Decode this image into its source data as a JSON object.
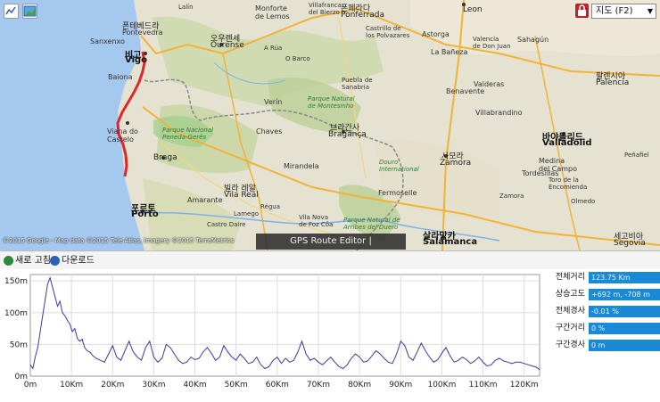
{
  "map": {
    "toolbar": {
      "measure_icon": "route-chart-icon",
      "image_icon": "landscape-image-icon"
    },
    "lock_icon": "padlock-icon",
    "map_type_select": "지도 (F2)",
    "copyright": "©2015 Google - Map data ©2015 Tele Atlas, Imagery ©2015 TerraMetrics",
    "brand": "GPS Route Editor | www.gpsnote.net",
    "labels": {
      "pontevedra_kr": "폰테베드라",
      "pontevedra": "Pontevedra",
      "sanxenxo": "Sanxenxo",
      "vigo_kr": "비고",
      "vigo": "Vigo",
      "baiona": "Baiona",
      "ourense_kr": "오우렌세",
      "ourense": "Ourense",
      "monforte": "Monforte\nde Lemos",
      "ponferrada_kr": "폰페라다",
      "ponferrada": "Ponferrada",
      "villafranca": "Villafranca\ndel Bierzo",
      "leon": "Leon",
      "astorga": "Astorga",
      "la_baneza": "La Bañeza",
      "sahagun": "Sahagún",
      "valencia_de_don_juan": "Valencia\nde Don Juan",
      "palencia_kr": "팔렌시아",
      "palencia": "Palencia",
      "benavente": "Benavente",
      "valderas": "Valderas",
      "villabrandino": "Villabrandino",
      "valladolid_kr": "바야돌리드",
      "valladolid": "Valladolid",
      "zamora_kr": "사모라",
      "zamora": "Zamora",
      "medina": "Medina\ndel Campo",
      "tordesillas": "Tordesillas",
      "salamanca_kr": "살라망카",
      "salamanca": "Salamanca",
      "segovia_kr": "세고비아",
      "segovia": "Segovia",
      "braganca_kr": "브라간사",
      "braganca": "Bragança",
      "chaves": "Chaves",
      "verin": "Verín",
      "braga": "Braga",
      "viana": "Viana do\nCastelo",
      "porto_kr": "포르토",
      "porto": "Porto",
      "vila_real_kr": "빌라 레알",
      "vila_real": "Vila Real",
      "amarante": "Amarante",
      "mirandela": "Mirandela",
      "fermoselle": "Fermoselle",
      "peneda": "Parque Nacional\nPeneda-Gerês",
      "montesinho": "Parque Natural\nde Montesinho",
      "arribes": "Parque Natural de\nArribes del Duero",
      "sanabria": "Puebla de\nSanabria",
      "o_barco": "O Barco",
      "a_rua": "A Rúa",
      "los_polvazares": "Castrillo de\nlos Polvazares",
      "la_encomienda": "Toro de la\nEncomienda",
      "olmedo": "Olmedo",
      "penafiel": "Peñafiel",
      "castro": "Castro Daire",
      "lamego": "Lamego",
      "regua": "Régua",
      "vila_nova_foz_coa": "Vila Nova\nde Foz Côa",
      "duoro_intl": "Douro\nInternational",
      "lalin": "Lalín",
      "zamora_region": "Zamora"
    }
  },
  "toolbar": {
    "refresh_label": "새로 고침",
    "download_label": "다운로드"
  },
  "chart_data": {
    "type": "area",
    "title": "",
    "xlabel": "",
    "ylabel": "",
    "x_unit": "Km",
    "y_unit": "m",
    "xlim": [
      0,
      123.75
    ],
    "ylim": [
      0,
      160
    ],
    "x_ticks": [
      "0m",
      "10Km",
      "20Km",
      "30Km",
      "40Km",
      "50Km",
      "60Km",
      "70Km",
      "80Km",
      "90Km",
      "100Km",
      "110Km",
      "120Km"
    ],
    "y_ticks": [
      "0m",
      "50m",
      "100m",
      "150m"
    ],
    "grid": true,
    "series": [
      {
        "color": "#3a3aa0",
        "x": [
          0,
          0.6,
          1.2,
          1.8,
          2.4,
          3.0,
          3.6,
          4.2,
          4.8,
          5.4,
          6.0,
          6.6,
          7.2,
          7.8,
          8.4,
          9.0,
          9.6,
          10.2,
          10.8,
          11.4,
          12.0,
          12.6,
          13.2,
          13.8,
          14.5,
          15.2,
          16.0,
          17.0,
          18.0,
          19.0,
          20.0,
          21.0,
          22.0,
          23.0,
          24.0,
          25.0,
          26.0,
          27.0,
          28.0,
          29.0,
          30.0,
          31.0,
          32.0,
          33.0,
          34.0,
          35.0,
          36.0,
          37.0,
          38.0,
          39.0,
          40.0,
          41.0,
          42.0,
          43.0,
          44.0,
          45.0,
          46.0,
          47.0,
          48.0,
          49.0,
          50.0,
          51.0,
          52.0,
          53.0,
          54.0,
          55.0,
          56.0,
          57.0,
          58.0,
          59.0,
          60.0,
          61.0,
          62.0,
          63.0,
          64.0,
          65.0,
          66.0,
          67.0,
          68.0,
          69.0,
          70.0,
          71.0,
          72.0,
          73.0,
          74.0,
          75.0,
          76.0,
          77.0,
          78.0,
          79.0,
          80.0,
          81.0,
          82.0,
          83.0,
          84.0,
          85.0,
          86.0,
          87.0,
          88.0,
          89.0,
          90.0,
          91.0,
          92.0,
          93.0,
          94.0,
          95.0,
          96.0,
          97.0,
          98.0,
          99.0,
          100.0,
          101.0,
          102.0,
          103.0,
          104.0,
          105.0,
          106.0,
          107.0,
          108.0,
          109.0,
          110.0,
          111.0,
          112.0,
          113.0,
          114.0,
          115.0,
          116.0,
          117.0,
          118.0,
          119.0,
          120.0,
          121.0,
          122.0,
          123.0,
          123.75
        ],
        "values": [
          18,
          12,
          30,
          45,
          70,
          95,
          120,
          145,
          155,
          140,
          125,
          110,
          118,
          100,
          95,
          88,
          82,
          70,
          75,
          60,
          55,
          58,
          45,
          40,
          38,
          32,
          28,
          25,
          22,
          35,
          48,
          30,
          25,
          40,
          55,
          38,
          30,
          25,
          45,
          55,
          30,
          22,
          28,
          50,
          45,
          35,
          25,
          20,
          22,
          30,
          26,
          28,
          38,
          45,
          36,
          25,
          30,
          48,
          38,
          30,
          25,
          35,
          28,
          20,
          22,
          30,
          18,
          12,
          15,
          25,
          30,
          20,
          28,
          22,
          25,
          38,
          55,
          35,
          25,
          28,
          22,
          18,
          24,
          30,
          22,
          15,
          12,
          18,
          28,
          35,
          30,
          22,
          24,
          32,
          40,
          35,
          28,
          22,
          20,
          35,
          55,
          48,
          30,
          25,
          38,
          52,
          40,
          30,
          22,
          26,
          36,
          45,
          32,
          22,
          25,
          30,
          26,
          20,
          24,
          30,
          22,
          16,
          18,
          25,
          28,
          24,
          22,
          20,
          22,
          22,
          20,
          18,
          16,
          14,
          10
        ]
      }
    ]
  },
  "stats": {
    "rows": [
      {
        "label": "전체거리",
        "value": "123.75 Km"
      },
      {
        "label": "상승고도",
        "value": "+692 m, -708 m"
      },
      {
        "label": "전체경사",
        "value": "-0.01 %"
      },
      {
        "label": "구간거리",
        "value": "0 %"
      },
      {
        "label": "구간경사",
        "value": "0 m"
      }
    ]
  }
}
